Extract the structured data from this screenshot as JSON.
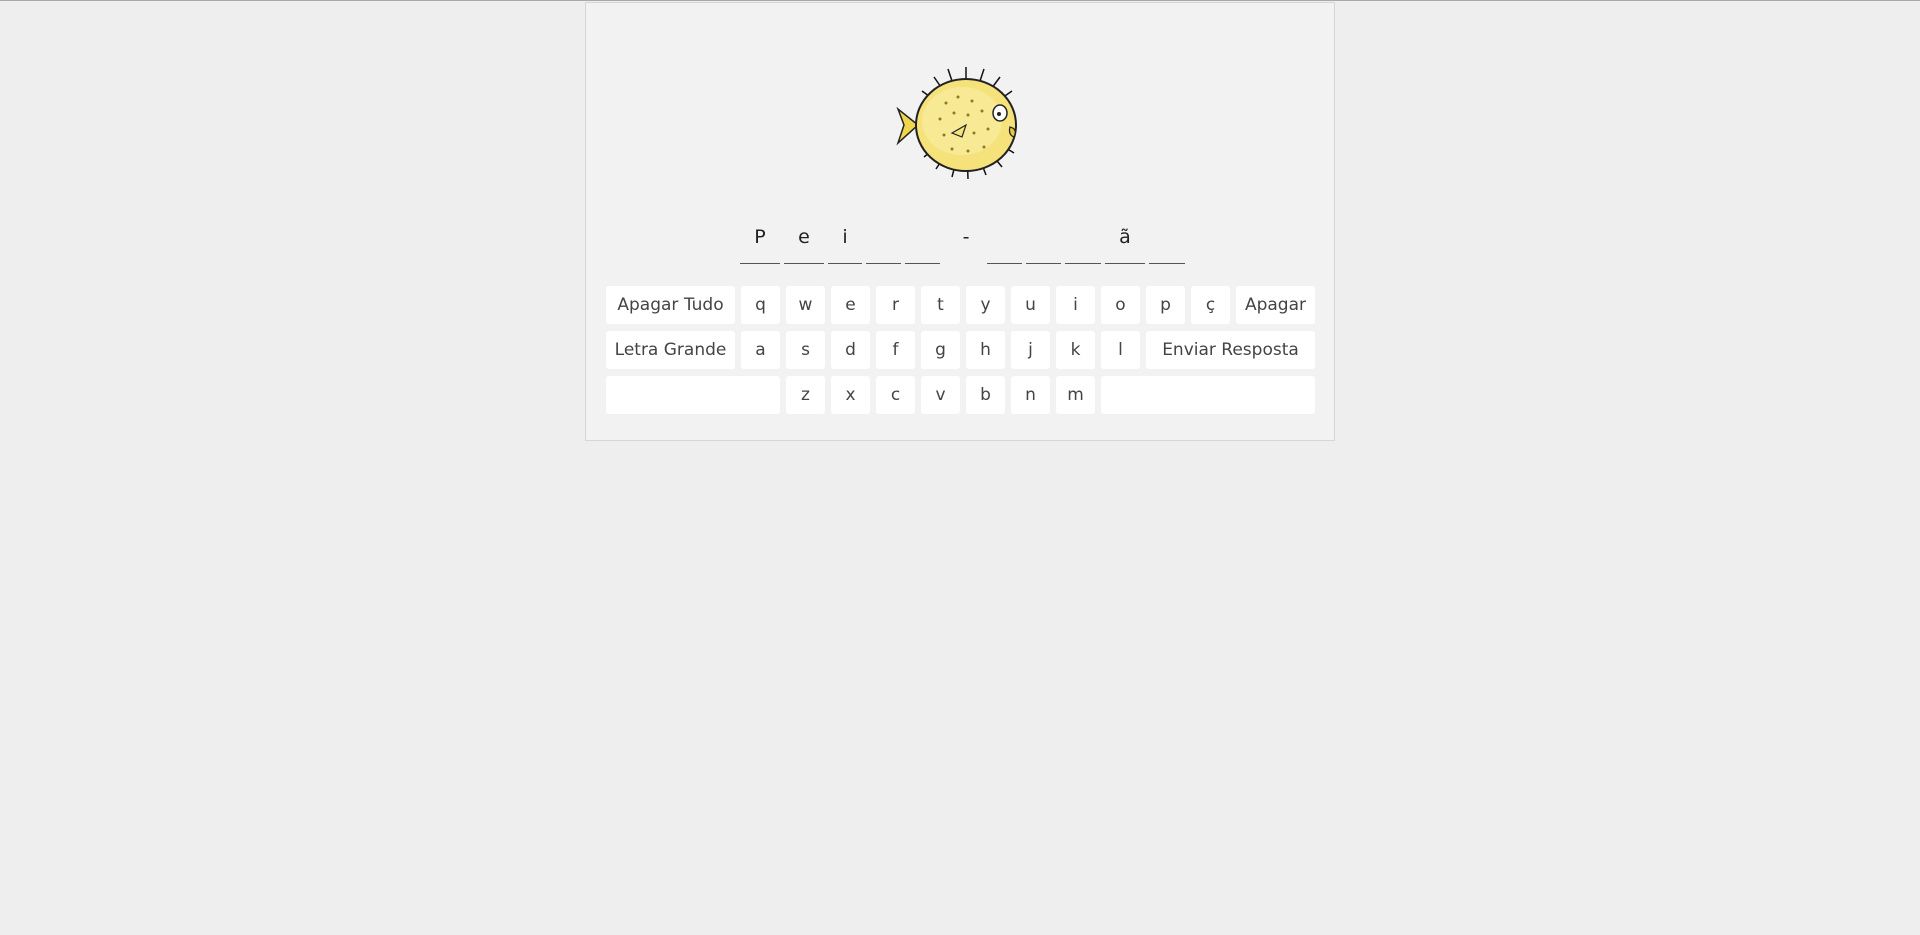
{
  "game": {
    "mascot_icon": "pufferfish-icon",
    "slots": [
      {
        "char": "P"
      },
      {
        "char": "e"
      },
      {
        "char": "i"
      },
      {
        "char": ""
      },
      {
        "char": ""
      }
    ],
    "separator": "-",
    "slots2": [
      {
        "char": ""
      },
      {
        "char": ""
      },
      {
        "char": ""
      },
      {
        "char": "ã"
      },
      {
        "char": ""
      }
    ]
  },
  "keyboard": {
    "clear_all": "Apagar Tudo",
    "backspace": "Apagar",
    "uppercase": "Letra Grande",
    "submit": "Enviar Resposta",
    "row1": [
      "q",
      "w",
      "e",
      "r",
      "t",
      "y",
      "u",
      "i",
      "o",
      "p",
      "ç"
    ],
    "row2": [
      "a",
      "s",
      "d",
      "f",
      "g",
      "h",
      "j",
      "k",
      "l"
    ],
    "row3": [
      "z",
      "x",
      "c",
      "v",
      "b",
      "n",
      "m"
    ]
  }
}
